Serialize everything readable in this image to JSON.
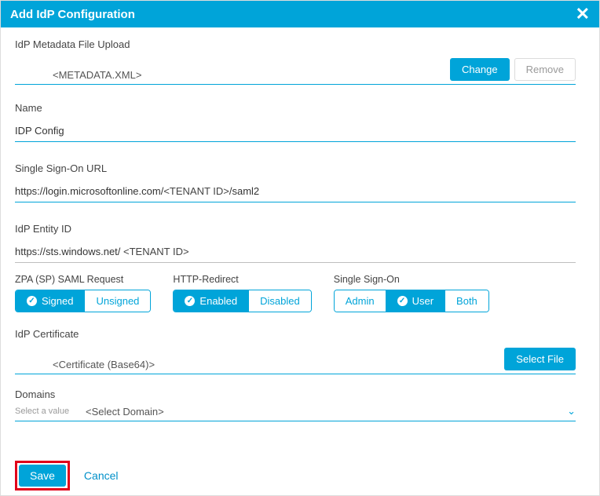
{
  "dialog": {
    "title": "Add IdP Configuration"
  },
  "metadata": {
    "label": "IdP Metadata File Upload",
    "filename": "<METADATA.XML>",
    "change": "Change",
    "remove": "Remove"
  },
  "name": {
    "label": "Name",
    "value": "IDP Config"
  },
  "sso_url": {
    "label": "Single Sign-On URL",
    "prefix": "https://login.microsoftonline.com/",
    "placeholder": "<TENANT ID>",
    "suffix": "/saml2"
  },
  "entity_id": {
    "label": "IdP Entity ID",
    "prefix": "https://sts.windows.net/ ",
    "placeholder": "<TENANT ID>"
  },
  "segments": {
    "saml": {
      "label": "ZPA (SP) SAML Request",
      "signed": "Signed",
      "unsigned": "Unsigned"
    },
    "http": {
      "label": "HTTP-Redirect",
      "enabled": "Enabled",
      "disabled": "Disabled"
    },
    "sso": {
      "label": "Single Sign-On",
      "admin": "Admin",
      "user": "User",
      "both": "Both"
    }
  },
  "cert": {
    "label": "IdP Certificate",
    "placeholder": "<Certificate (Base64)>",
    "select_file": "Select File"
  },
  "domains": {
    "label": "Domains",
    "hint": "Select a value",
    "placeholder": "<Select Domain>"
  },
  "footer": {
    "save": "Save",
    "cancel": "Cancel"
  }
}
